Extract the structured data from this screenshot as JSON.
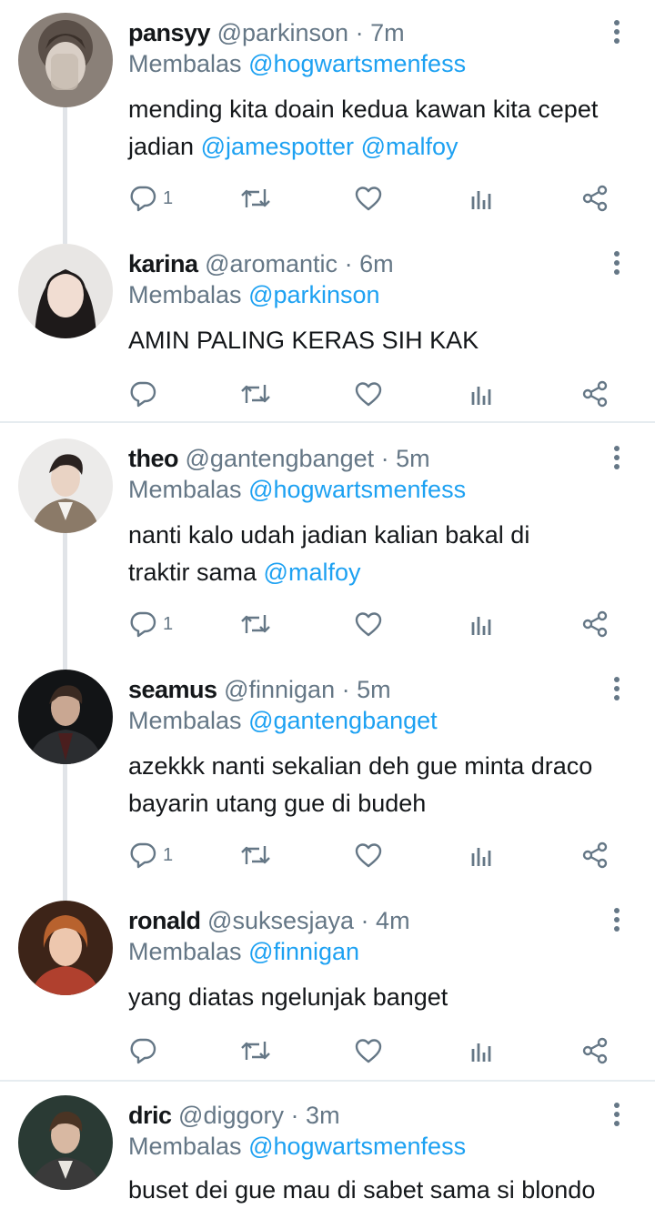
{
  "reply_prefix": "Membalas",
  "colors": {
    "accent": "#1da1f2",
    "muted": "#657786",
    "text": "#14171a"
  },
  "tweets": [
    {
      "name": "pansyy",
      "handle": "@parkinson",
      "sep": "·",
      "time": "7m",
      "reply_to": "@hogwartsmenfess",
      "text_1": "mending kita doain kedua kawan kita cepet",
      "text_2": "jadian",
      "mention_a": "@jamespotter",
      "mention_b": "@malfoy",
      "reply_count": "1"
    },
    {
      "name": "karina",
      "handle": "@aromantic",
      "sep": "·",
      "time": "6m",
      "reply_to": "@parkinson",
      "text_1": "AMIN PALING KERAS SIH KAK",
      "reply_count": ""
    },
    {
      "name": "theo",
      "handle": "@gantengbanget",
      "sep": "·",
      "time": "5m",
      "reply_to": "@hogwartsmenfess",
      "text_1": "nanti kalo udah jadian kalian bakal di",
      "text_2": "traktir sama",
      "mention_a": "@malfoy",
      "reply_count": "1"
    },
    {
      "name": "seamus",
      "handle": "@finnigan",
      "sep": "·",
      "time": "5m",
      "reply_to": "@gantengbanget",
      "text_1": "azekkk nanti sekalian deh gue minta draco",
      "text_2": "bayarin utang gue di budeh",
      "reply_count": "1"
    },
    {
      "name": "ronald",
      "handle": "@suksesjaya",
      "sep": "·",
      "time": "4m",
      "reply_to": "@finnigan",
      "text_1": "yang diatas ngelunjak banget",
      "reply_count": ""
    },
    {
      "name": "dric",
      "handle": "@diggory",
      "sep": "·",
      "time": "3m",
      "reply_to": "@hogwartsmenfess",
      "text_1": "buset dei gue mau di sabet sama si blondo",
      "reply_count": ""
    }
  ],
  "icons": {
    "reply": "reply-icon",
    "retweet": "retweet-icon",
    "like": "heart-icon",
    "analytics": "analytics-icon",
    "share": "share-icon",
    "more": "more-vertical-icon"
  }
}
